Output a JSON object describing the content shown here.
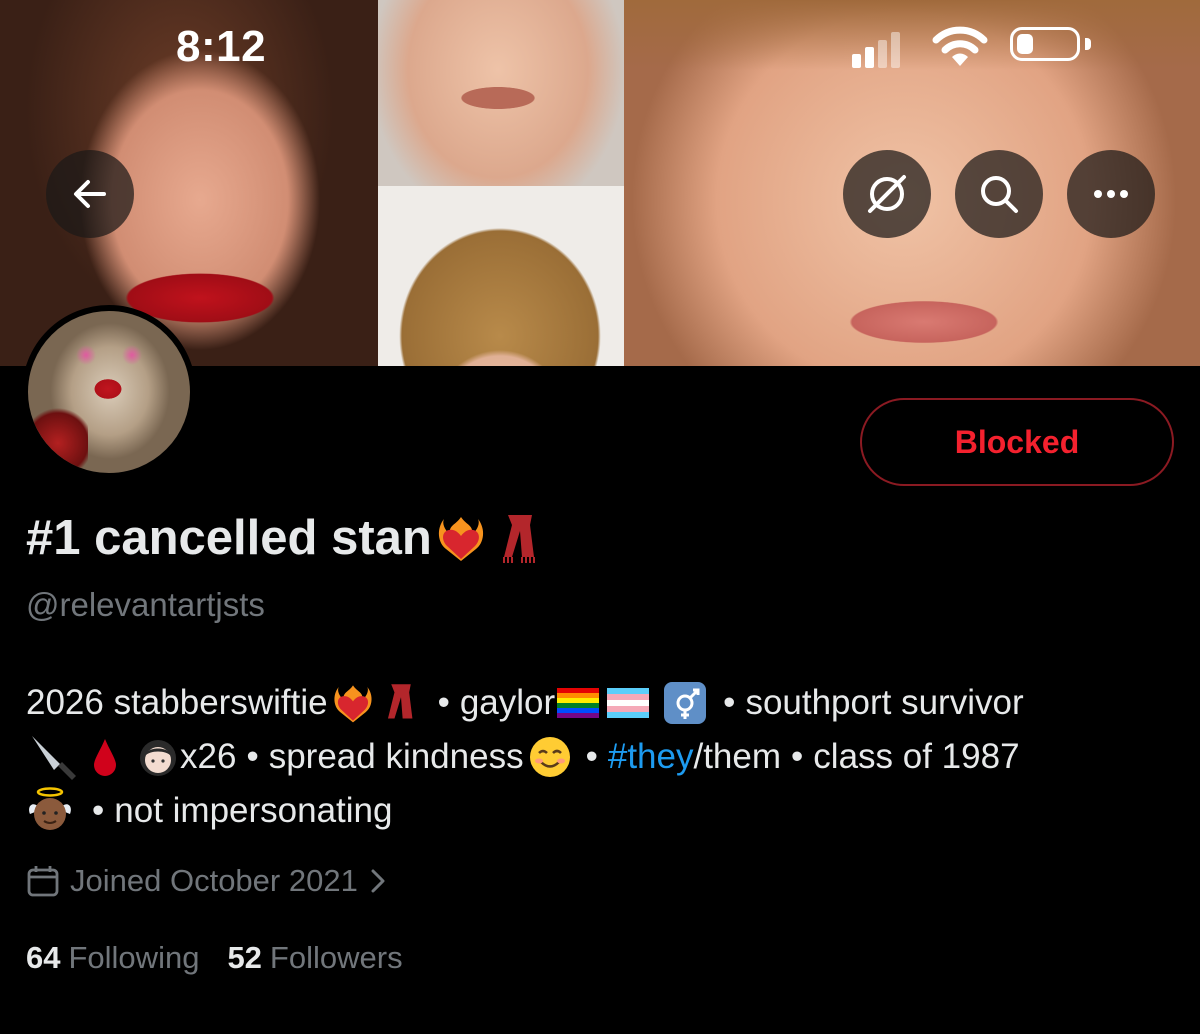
{
  "status_bar": {
    "time": "8:12"
  },
  "header": {
    "back_icon": "arrow-left-icon",
    "actions": [
      {
        "name": "grok-icon"
      },
      {
        "name": "search-icon"
      },
      {
        "name": "more-icon"
      }
    ]
  },
  "profile": {
    "display_name": "#1 cancelled stan",
    "handle": "@relevantartjsts",
    "blocked_label": "Blocked",
    "bio": {
      "line1_a": "2026 stabberswiftie",
      "line1_b": "•",
      "line1_c": "gaylor",
      "line1_d": "•",
      "line1_e": "southport survivor",
      "line2_a": "x26",
      "line2_b": "•",
      "line2_c": "spread kindness",
      "line2_d": "•",
      "line2_hashtag": "#they",
      "line2_e": "/them",
      "line2_f": "•",
      "line2_g": "class of 1987",
      "line3_a": "•",
      "line3_b": "not impersonating"
    },
    "joined": "Joined October 2021",
    "following_count": "64",
    "following_label": "Following",
    "followers_count": "52",
    "followers_label": "Followers"
  },
  "colors": {
    "accent_blue": "#1d9bf0",
    "blocked_red": "#f4212e",
    "muted_text": "#71767b",
    "background": "#000000"
  }
}
